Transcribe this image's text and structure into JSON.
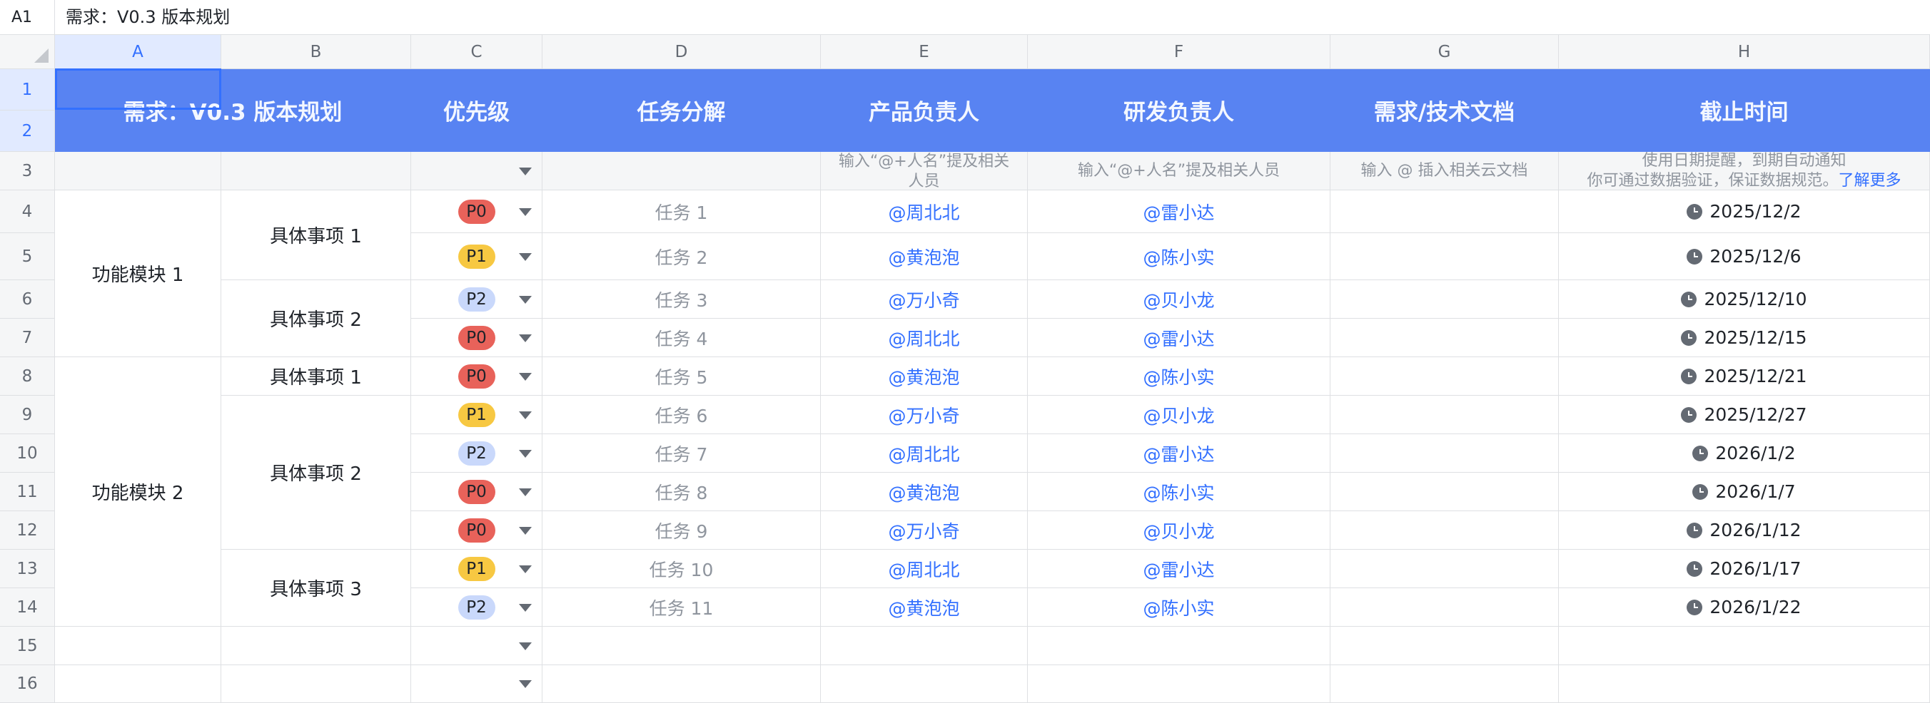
{
  "formula_bar": {
    "cell_ref": "A1",
    "value": "需求：V0.3 版本规划"
  },
  "columns": [
    "A",
    "B",
    "C",
    "D",
    "E",
    "F",
    "G",
    "H"
  ],
  "rows": [
    "1",
    "2",
    "3",
    "4",
    "5",
    "6",
    "7",
    "8",
    "9",
    "10",
    "11",
    "12",
    "13",
    "14",
    "15",
    "16"
  ],
  "header": {
    "title": "需求：V0.3 版本规划",
    "priority": "优先级",
    "task": "任务分解",
    "pm": "产品负责人",
    "dev": "研发负责人",
    "doc": "需求/技术文档",
    "deadline": "截止时间"
  },
  "hints": {
    "pm": "输入“@+人名”提及相关人员",
    "dev": "输入“@+人名”提及相关人员",
    "doc": "输入 @ 插入相关云文档",
    "deadline_line1": "使用日期提醒，到期自动通知",
    "deadline_line2": "你可通过数据验证，保证数据规范。",
    "deadline_link": "了解更多"
  },
  "modules": [
    "功能模块 1",
    "功能模块 2"
  ],
  "items": [
    "具体事项 1",
    "具体事项 2",
    "具体事项 1",
    "具体事项 2",
    "具体事项 3"
  ],
  "tasks": [
    {
      "priority": "P0",
      "task": "任务 1",
      "pm": "@周北北",
      "dev": "@雷小达",
      "date": "2025/12/2"
    },
    {
      "priority": "P1",
      "task": "任务 2",
      "pm": "@黄泡泡",
      "dev": "@陈小实",
      "date": "2025/12/6"
    },
    {
      "priority": "P2",
      "task": "任务 3",
      "pm": "@万小奇",
      "dev": "@贝小龙",
      "date": "2025/12/10"
    },
    {
      "priority": "P0",
      "task": "任务 4",
      "pm": "@周北北",
      "dev": "@雷小达",
      "date": "2025/12/15"
    },
    {
      "priority": "P0",
      "task": "任务 5",
      "pm": "@黄泡泡",
      "dev": "@陈小实",
      "date": "2025/12/21"
    },
    {
      "priority": "P1",
      "task": "任务 6",
      "pm": "@万小奇",
      "dev": "@贝小龙",
      "date": "2025/12/27"
    },
    {
      "priority": "P2",
      "task": "任务 7",
      "pm": "@周北北",
      "dev": "@雷小达",
      "date": "2026/1/2"
    },
    {
      "priority": "P0",
      "task": "任务 8",
      "pm": "@黄泡泡",
      "dev": "@陈小实",
      "date": "2026/1/7"
    },
    {
      "priority": "P0",
      "task": "任务 9",
      "pm": "@万小奇",
      "dev": "@贝小龙",
      "date": "2026/1/12"
    },
    {
      "priority": "P1",
      "task": "任务 10",
      "pm": "@周北北",
      "dev": "@雷小达",
      "date": "2026/1/17"
    },
    {
      "priority": "P2",
      "task": "任务 11",
      "pm": "@黄泡泡",
      "dev": "@陈小实",
      "date": "2026/1/22"
    }
  ],
  "colors": {
    "header_bg": "#5b84f2",
    "p0": "#e8625a",
    "p1": "#f7c842",
    "p2": "#c9d8fb",
    "mention": "#3370ff"
  }
}
